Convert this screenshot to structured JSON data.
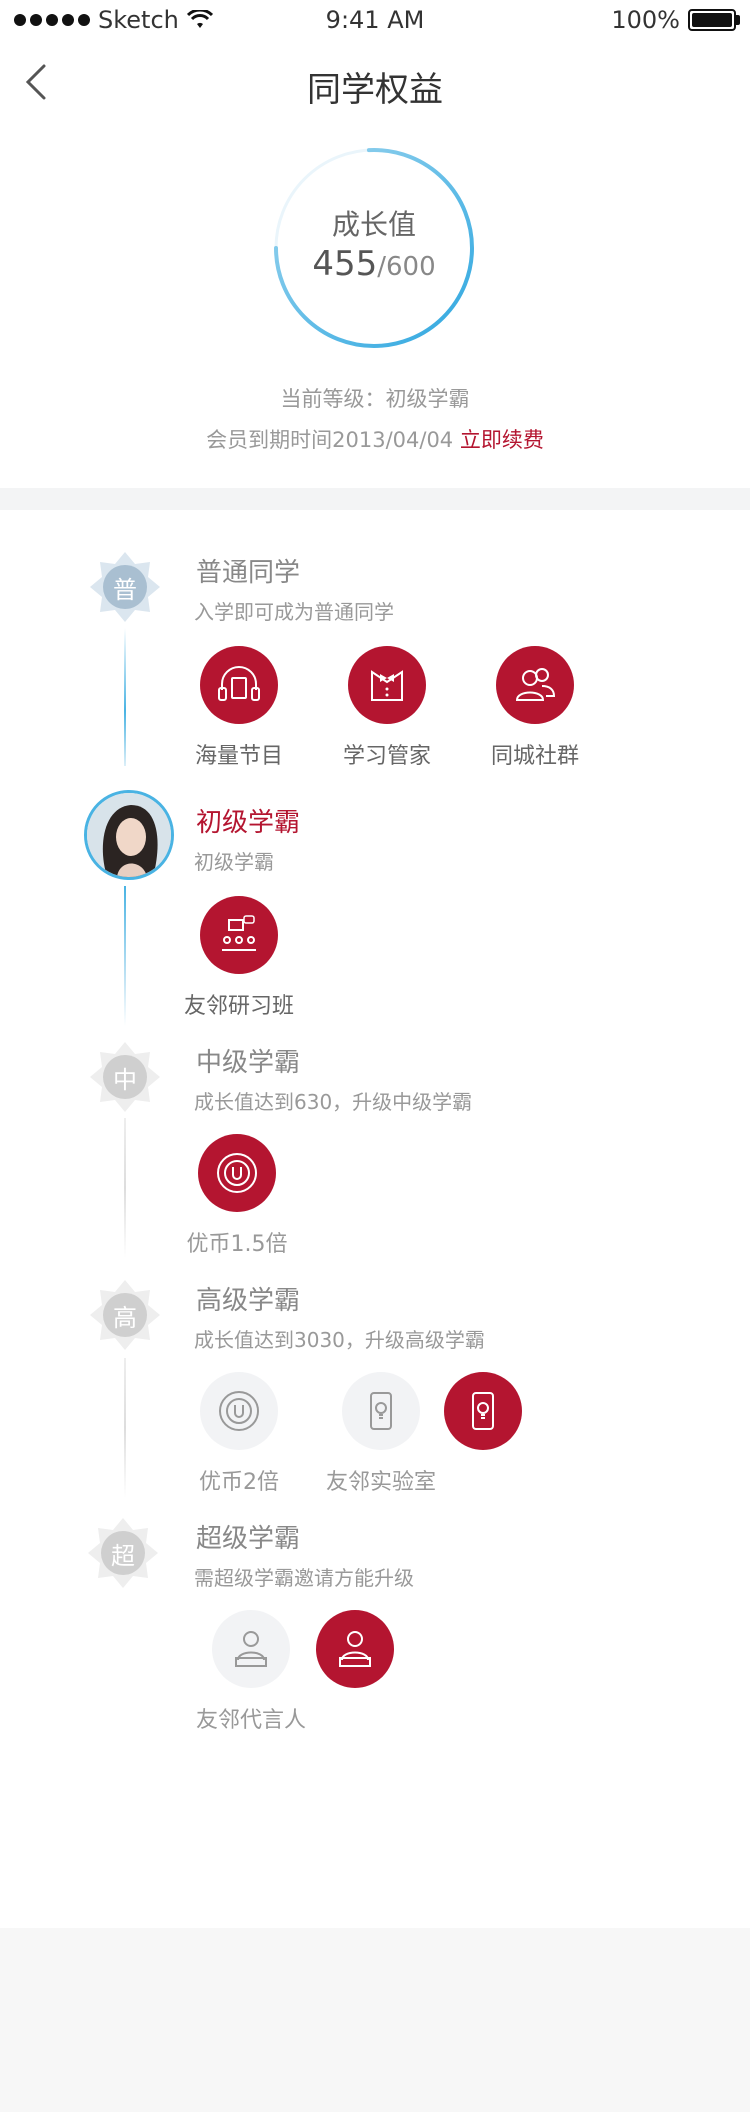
{
  "status_bar": {
    "carrier": "Sketch",
    "time": "9:41 AM",
    "battery": "100%"
  },
  "nav": {
    "title": "同学权益",
    "back_icon": "chevron-left-icon"
  },
  "growth": {
    "label": "成长值",
    "current": "455",
    "total": "/600",
    "progress": 0.758
  },
  "current_level": "当前等级：初级学霸",
  "expire_text": "会员到期时间2013/04/04",
  "renew_label": "立即续费",
  "colors": {
    "accent": "#b41530",
    "ring": "#2ea7e0",
    "timeline": "#49b3e3"
  },
  "levels": [
    {
      "badge": "普",
      "title": "普通同学",
      "subtitle": "入学即可成为普通同学",
      "perks": [
        {
          "label": "海量节目",
          "icon": "headphones-book-icon"
        },
        {
          "label": "学习管家",
          "icon": "butler-bowtie-icon"
        },
        {
          "label": "同城社群",
          "icon": "group-people-icon"
        }
      ]
    },
    {
      "badge": "",
      "title": "初级学霸",
      "subtitle": "初级学霸",
      "perks": [
        {
          "label": "友邻研习班",
          "icon": "classroom-icon"
        }
      ]
    },
    {
      "badge": "中",
      "title": "中级学霸",
      "subtitle": "成长值达到630，升级中级学霸",
      "perks": [
        {
          "label": "优币1.5倍",
          "icon": "coin-u-icon"
        }
      ]
    },
    {
      "badge": "高",
      "title": "高级学霸",
      "subtitle": "成长值达到3030，升级高级学霸",
      "perks": [
        {
          "label": "优币2倍",
          "icon": "coin-u-icon"
        },
        {
          "label": "友邻实验室",
          "icon": "tablet-bulb-icon"
        },
        {
          "label": "",
          "icon": "tablet-bulb-icon"
        }
      ]
    },
    {
      "badge": "超",
      "title": "超级学霸",
      "subtitle": "需超级学霸邀请方能升级",
      "perks": [
        {
          "label": "友邻代言人",
          "icon": "speaker-person-icon"
        },
        {
          "label": "",
          "icon": "speaker-person-icon"
        }
      ]
    }
  ]
}
